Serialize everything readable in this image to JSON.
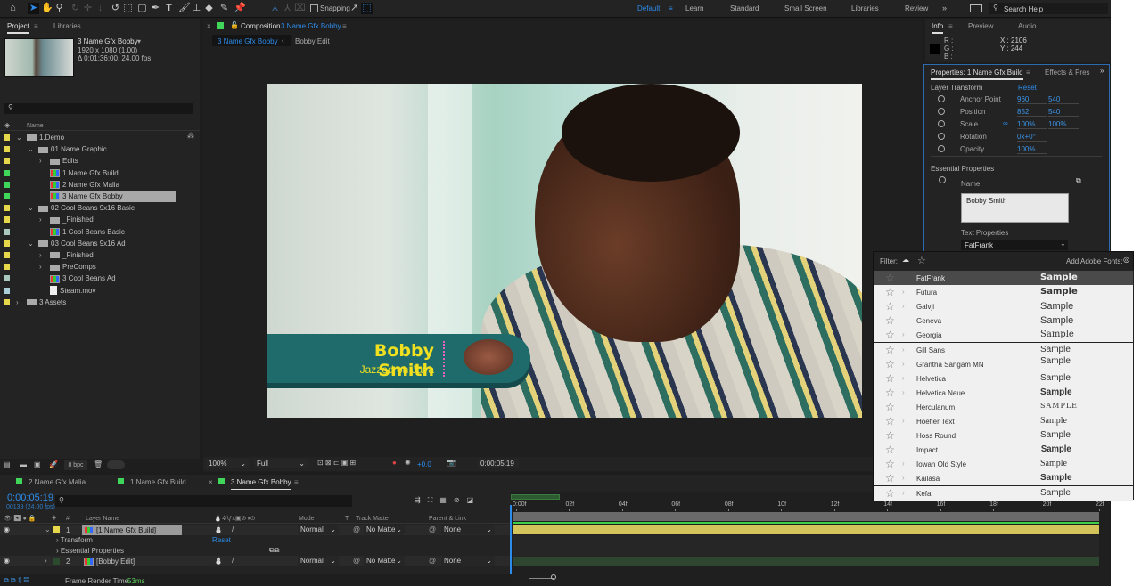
{
  "toolbar": {
    "snapping_label": "Snapping"
  },
  "workspaces": {
    "items": [
      "Default",
      "Learn",
      "Standard",
      "Small Screen",
      "Libraries",
      "Review"
    ],
    "active": "Default",
    "search_placeholder": "Search Help"
  },
  "project": {
    "tabs": [
      "Project",
      "Libraries"
    ],
    "selected_name": "3 Name Gfx Bobby",
    "selected_size": "1920 x 1080 (1.00)",
    "selected_duration": "Δ 0:01:36:00, 24.00 fps",
    "column_name": "Name",
    "bpc": "8 bpc",
    "items": [
      {
        "name": "1.Demo",
        "type": "folder",
        "depth": 0,
        "expanded": true,
        "label": "#e6d84a"
      },
      {
        "name": "01 Name Graphic",
        "type": "folder",
        "depth": 1,
        "expanded": true,
        "label": "#e6d84a"
      },
      {
        "name": "Edits",
        "type": "folder",
        "depth": 2,
        "expanded": false,
        "label": "#e6d84a"
      },
      {
        "name": "1 Name Gfx Build",
        "type": "comp",
        "depth": 2,
        "label": "#3fd65a"
      },
      {
        "name": "2 Name Gfx Malia",
        "type": "comp",
        "depth": 2,
        "label": "#3fd65a"
      },
      {
        "name": "3 Name Gfx Bobby",
        "type": "comp",
        "depth": 2,
        "label": "#3fd65a",
        "selected": true
      },
      {
        "name": "02 Cool Beans 9x16 Basic",
        "type": "folder",
        "depth": 1,
        "expanded": true,
        "label": "#e6d84a"
      },
      {
        "name": "_Finished",
        "type": "folder",
        "depth": 2,
        "expanded": false,
        "label": "#e6d84a"
      },
      {
        "name": "1 Cool Beans Basic",
        "type": "comp",
        "depth": 2,
        "label": "#a9c9bc"
      },
      {
        "name": "03 Cool Beans 9x16 Ad",
        "type": "folder",
        "depth": 1,
        "expanded": true,
        "label": "#e6d84a"
      },
      {
        "name": "_Finished",
        "type": "folder",
        "depth": 2,
        "expanded": false,
        "label": "#e6d84a"
      },
      {
        "name": "PreComps",
        "type": "folder",
        "depth": 2,
        "expanded": false,
        "label": "#e6d84a"
      },
      {
        "name": "3 Cool Beans Ad",
        "type": "comp",
        "depth": 2,
        "label": "#a9c9bc"
      },
      {
        "name": "Steam.mov",
        "type": "footage",
        "depth": 2,
        "label": "#a9d0d6"
      },
      {
        "name": "3 Assets",
        "type": "folder",
        "depth": 0,
        "expanded": false,
        "label": "#e6d84a"
      }
    ]
  },
  "composition": {
    "tab_prefix": "Composition",
    "tab_name": "3 Name Gfx Bobby",
    "breadcrumbs": [
      "3 Name Gfx Bobby",
      "Bobby Edit"
    ],
    "zoom": "100%",
    "resolution": "Full",
    "exposure": "+0.0",
    "timecode": "0:00:05:19",
    "graphic": {
      "name": "Bobby Smith",
      "tagline": "Jazzed on Java"
    }
  },
  "info": {
    "tabs": [
      "Info",
      "Preview",
      "Audio"
    ],
    "r": "R :",
    "g": "G :",
    "b": "B :",
    "x": "X : 2106",
    "y": "Y : 244"
  },
  "properties": {
    "tabs": [
      "Properties: 1 Name Gfx Build",
      "Effects & Pres"
    ],
    "layer_transform": "Layer Transform",
    "reset": "Reset",
    "rows": [
      {
        "name": "Anchor Point",
        "v1": "960",
        "v2": "540"
      },
      {
        "name": "Position",
        "v1": "852",
        "v2": "540"
      },
      {
        "name": "Scale",
        "v1": "100%",
        "v2": "100%"
      },
      {
        "name": "Rotation",
        "v1": "0x+0°"
      },
      {
        "name": "Opacity",
        "v1": "100%"
      }
    ],
    "essential": "Essential Properties",
    "name_label": "Name",
    "name_value": "Bobby Smith",
    "text_props": "Text Properties",
    "font": "FatFrank"
  },
  "font_menu": {
    "filter_label": "Filter:",
    "add_fonts": "Add Adobe Fonts:",
    "sample": "Sample",
    "fonts": [
      {
        "name": "FatFrank",
        "variants": false,
        "highlighted": true
      },
      {
        "name": "Futura",
        "variants": true
      },
      {
        "name": "Galvji",
        "variants": true
      },
      {
        "name": "Geneva",
        "variants": false
      },
      {
        "name": "Georgia",
        "variants": true
      },
      {
        "name": "Gill Sans",
        "variants": true
      },
      {
        "name": "Grantha Sangam MN",
        "variants": true
      },
      {
        "name": "Helvetica",
        "variants": true
      },
      {
        "name": "Helvetica Neue",
        "variants": true
      },
      {
        "name": "Herculanum",
        "variants": false,
        "sample": "SAMPLE"
      },
      {
        "name": "Hoefler Text",
        "variants": true
      },
      {
        "name": "Hoss Round",
        "variants": false
      },
      {
        "name": "Impact",
        "variants": false
      },
      {
        "name": "Iowan Old Style",
        "variants": true
      },
      {
        "name": "Kailasa",
        "variants": true
      },
      {
        "name": "Kefa",
        "variants": true
      }
    ]
  },
  "timeline": {
    "tabs": [
      {
        "name": "2 Name Gfx Malia"
      },
      {
        "name": "1 Name Gfx Build"
      },
      {
        "name": "3 Name Gfx Bobby",
        "active": true
      }
    ],
    "timecode": "0:00:05:19",
    "frames": "00139 (24.00 fps)",
    "col_num": "#",
    "col_layer": "Layer Name",
    "col_mode": "Mode",
    "col_t": "T",
    "col_matte": "Track Matte",
    "col_parent": "Parent & Link",
    "layers": [
      {
        "num": "1",
        "name": "[1 Name Gfx Build]",
        "mode": "Normal",
        "matte": "No Matte",
        "parent": "None",
        "label": "#e6d84a",
        "bar": "#d4c35a"
      },
      {
        "num": "2",
        "name": "[Bobby Edit]",
        "mode": "Normal",
        "matte": "No Matte",
        "parent": "None",
        "label": "#2c4a2e",
        "bar": "#2e4530"
      }
    ],
    "sub_rows": [
      "Transform",
      "Essential Properties"
    ],
    "reset": "Reset",
    "ruler": [
      "0:00f",
      "02f",
      "04f",
      "06f",
      "08f",
      "10f",
      "12f",
      "14f",
      "16f",
      "18f",
      "20f",
      "22f"
    ],
    "render_label": "Frame Render Time",
    "render_value": "53ms"
  }
}
